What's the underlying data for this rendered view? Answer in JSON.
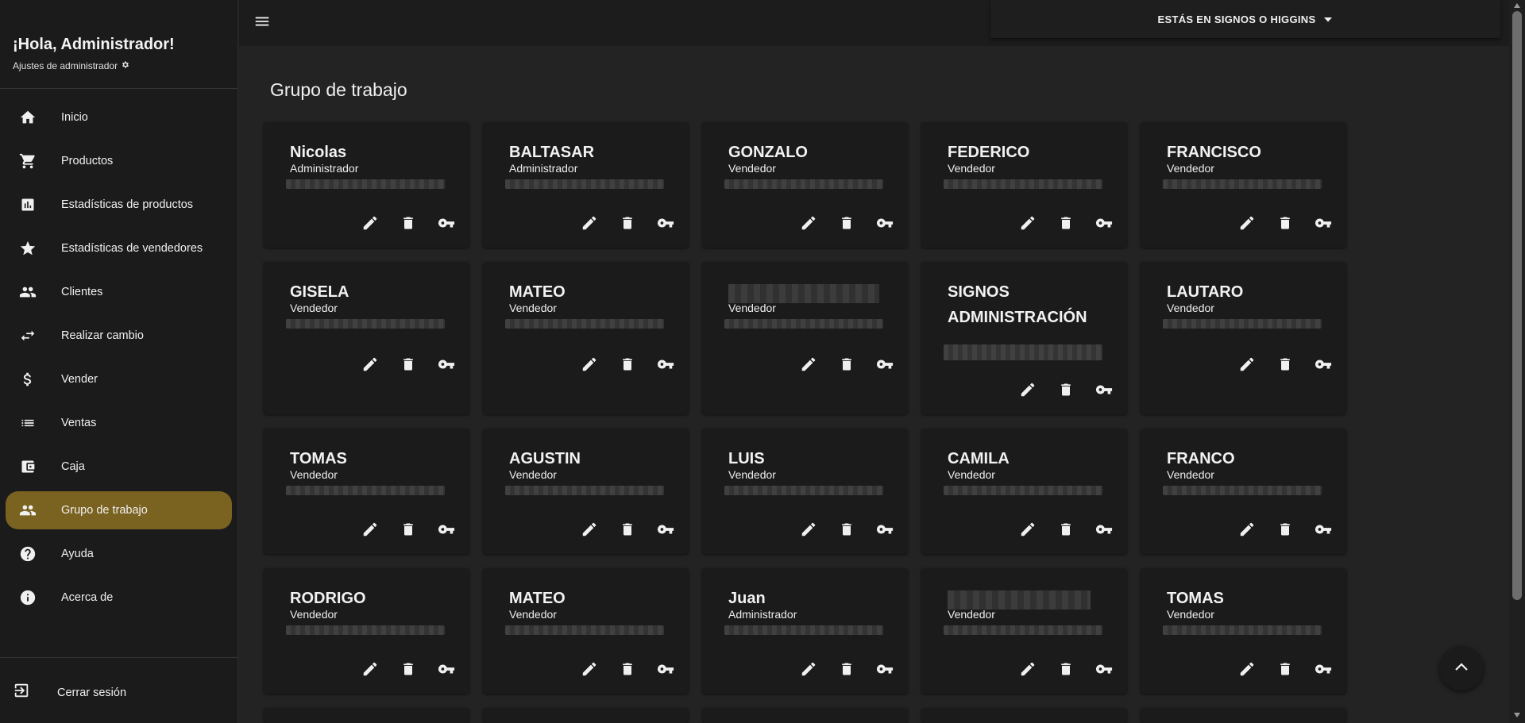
{
  "sidebar": {
    "greeting": "¡Hola, Administrador!",
    "settings_label": "Ajustes de administrador",
    "items": [
      {
        "label": "Inicio",
        "icon": "home-icon"
      },
      {
        "label": "Productos",
        "icon": "cart-icon"
      },
      {
        "label": "Estadísticas de productos",
        "icon": "bar-chart-icon"
      },
      {
        "label": "Estadísticas de vendedores",
        "icon": "star-icon"
      },
      {
        "label": "Clientes",
        "icon": "people-icon"
      },
      {
        "label": "Realizar cambio",
        "icon": "swap-icon"
      },
      {
        "label": "Vender",
        "icon": "dollar-icon"
      },
      {
        "label": "Ventas",
        "icon": "list-icon"
      },
      {
        "label": "Caja",
        "icon": "wallet-icon"
      },
      {
        "label": "Grupo de trabajo",
        "icon": "people-icon",
        "active": true
      },
      {
        "label": "Ayuda",
        "icon": "help-icon"
      },
      {
        "label": "Acerca de",
        "icon": "info-icon"
      }
    ],
    "logout_label": "Cerrar sesión"
  },
  "topbar": {
    "location_label": "ESTÁS EN SIGNOS O HIGGINS"
  },
  "main": {
    "title": "Grupo de trabajo",
    "cards": [
      {
        "name": "Nicolas",
        "role": "Administrador"
      },
      {
        "name": "BALTASAR",
        "role": "Administrador"
      },
      {
        "name": "GONZALO",
        "role": "Vendedor"
      },
      {
        "name": "FEDERICO",
        "role": "Vendedor"
      },
      {
        "name": "FRANCISCO",
        "role": "Vendedor"
      },
      {
        "name": "GISELA",
        "role": "Vendedor"
      },
      {
        "name": "MATEO",
        "role": "Vendedor"
      },
      {
        "name": "",
        "role": "Vendedor"
      },
      {
        "name": "SIGNOS ADMINISTRACIÓN",
        "role": ""
      },
      {
        "name": "LAUTARO",
        "role": "Vendedor"
      },
      {
        "name": "TOMAS",
        "role": "Vendedor"
      },
      {
        "name": "AGUSTIN",
        "role": "Vendedor"
      },
      {
        "name": "LUIS",
        "role": "Vendedor"
      },
      {
        "name": "CAMILA",
        "role": "Vendedor"
      },
      {
        "name": "FRANCO",
        "role": "Vendedor"
      },
      {
        "name": "RODRIGO",
        "role": "Vendedor"
      },
      {
        "name": "MATEO",
        "role": "Vendedor"
      },
      {
        "name": "Juan",
        "role": "Administrador"
      },
      {
        "name": "",
        "role": "Vendedor"
      },
      {
        "name": "TOMAS",
        "role": "Vendedor"
      }
    ]
  },
  "colors": {
    "accent": "#7a6220",
    "background": "#232323",
    "sidebar": "#1b1b1b",
    "card": "#1b1b1b"
  }
}
